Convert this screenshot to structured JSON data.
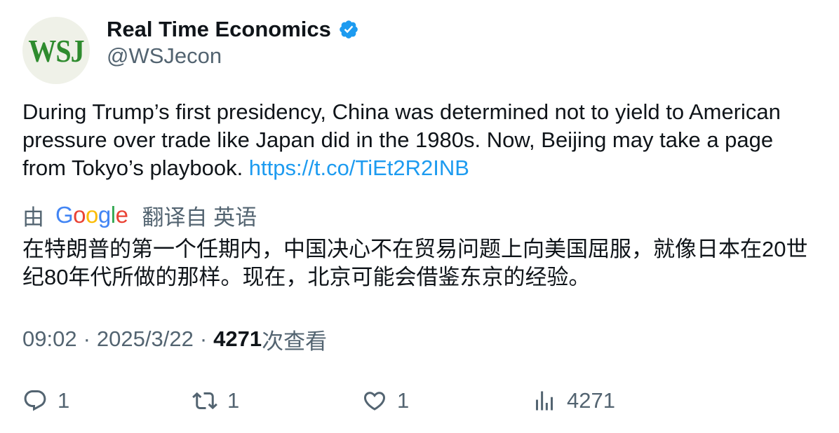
{
  "author": {
    "avatar_text": "WSJ",
    "display_name": "Real Time Economics",
    "handle": "@WSJecon",
    "verified_icon": "verified-badge-icon"
  },
  "tweet": {
    "text": "During Trump’s first presidency, China was determined not to yield to American pressure over trade like Japan did in the 1980s. Now, Beijing may take a page from Tokyo’s playbook. ",
    "link": "https://t.co/TiEt2R2INB"
  },
  "translation": {
    "prefix": "由",
    "provider_letters": [
      "G",
      "o",
      "o",
      "g",
      "l",
      "e"
    ],
    "label": "翻译自 英语",
    "text": "在特朗普的第一个任期内，中国决心不在贸易问题上向美国屈服，就像日本在20世纪80年代所做的那样。现在，北京可能会借鉴东京的经验。"
  },
  "meta": {
    "time": "09:02",
    "separator": "·",
    "date": "2025/3/22",
    "views_count": "4271",
    "views_label": "次查看"
  },
  "actions": {
    "reply_count": "1",
    "retweet_count": "1",
    "like_count": "1",
    "views_count": "4271"
  },
  "colors": {
    "link": "#1d9bf0",
    "secondary_text": "#536471",
    "verified": "#1d9bf0",
    "avatar_text": "#2e8b2e"
  }
}
